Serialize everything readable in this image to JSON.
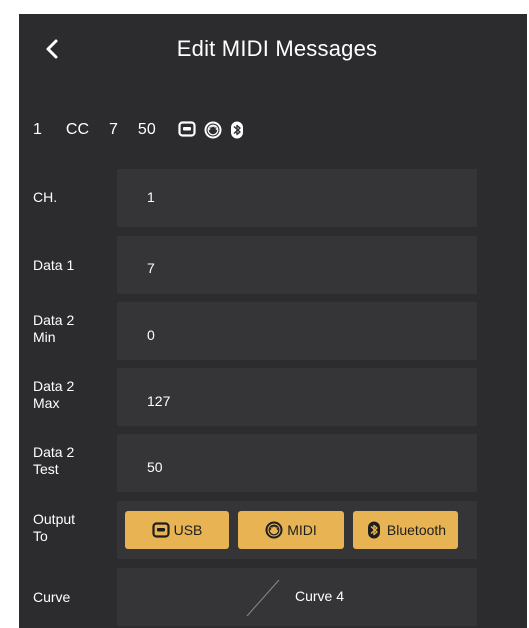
{
  "header": {
    "title": "Edit MIDI Messages"
  },
  "summary": {
    "channel": "1",
    "type": "CC",
    "data1": "7",
    "value": "50"
  },
  "fields": {
    "channel": {
      "label": "CH.",
      "value": "1"
    },
    "data1": {
      "label": "Data 1",
      "value": "7"
    },
    "data2_min": {
      "label": "Data 2\nMin",
      "value": "0"
    },
    "data2_max": {
      "label": "Data 2\nMax",
      "value": "127"
    },
    "data2_test": {
      "label": "Data 2\nTest",
      "value": "50"
    }
  },
  "output": {
    "label": "Output\nTo",
    "buttons": {
      "usb": "USB",
      "midi": "MIDI",
      "bluetooth": "Bluetooth"
    }
  },
  "curve": {
    "label": "Curve",
    "value": "Curve 4"
  },
  "colors": {
    "background": "#2c2c2e",
    "field": "#353537",
    "accent": "#e8b453"
  }
}
